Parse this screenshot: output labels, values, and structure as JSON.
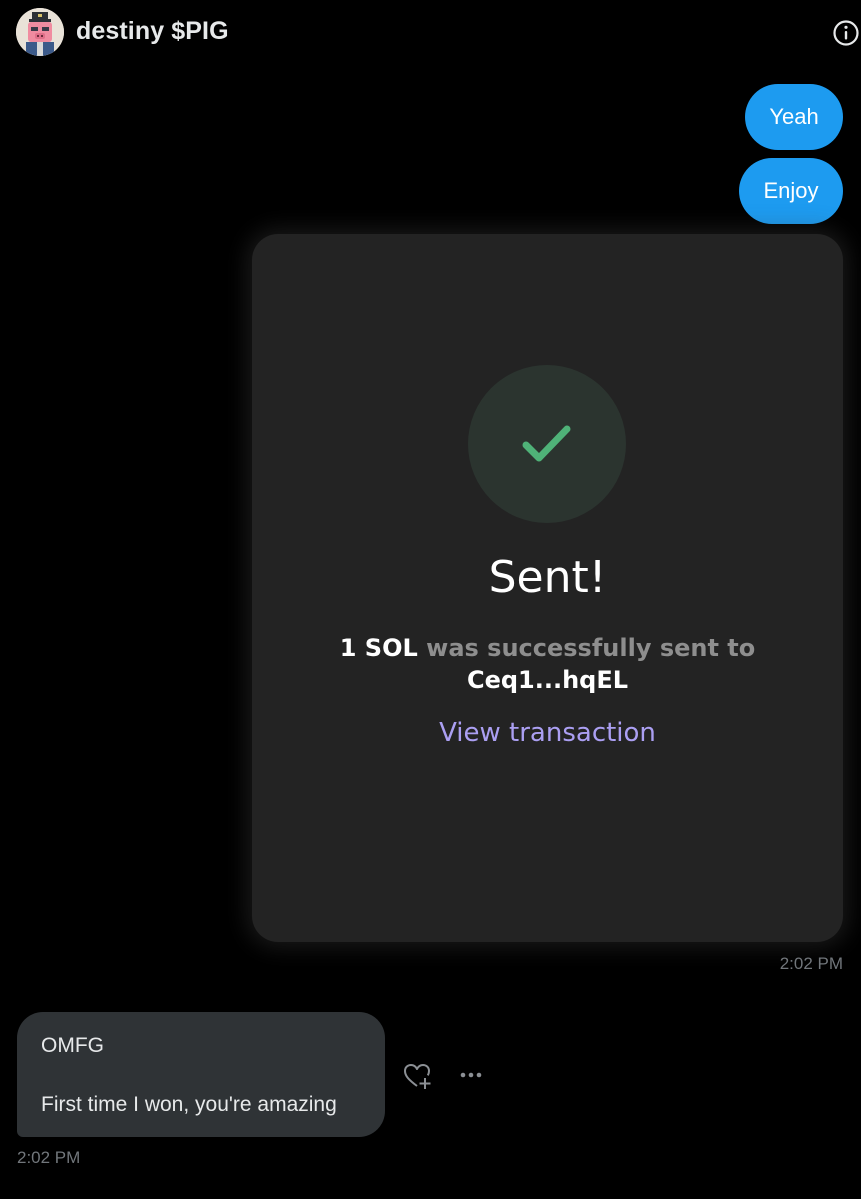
{
  "header": {
    "name": "destiny $PIG",
    "avatar_icon": "pig-avatar",
    "info_icon": "info-icon"
  },
  "messages_out": [
    {
      "text": "Yeah"
    },
    {
      "text": "Enjoy"
    }
  ],
  "transaction": {
    "status_icon": "checkmark-icon",
    "title": "Sent!",
    "amount": "1 SOL",
    "message": " was successfully sent to",
    "recipient": "Ceq1...hqEL",
    "link_label": "View transaction",
    "timestamp": "2:02 PM",
    "accent_color": "#ab9ff2",
    "check_color": "#4fb278"
  },
  "message_in": {
    "line1": "OMFG",
    "line2": "First time I won, you're amazing",
    "timestamp": "2:02 PM",
    "react_icon": "heart-plus-icon",
    "more_icon": "more-dots-icon"
  },
  "colors": {
    "outgoing_bubble": "#1d9bf0",
    "incoming_bubble": "#2f3336",
    "card_bg": "#232323",
    "muted_text": "#71767b"
  }
}
